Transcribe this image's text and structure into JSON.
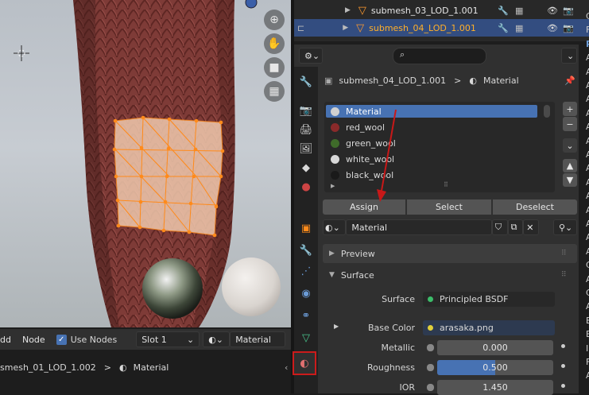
{
  "viewport": {
    "nav_icons": [
      "zoom-icon",
      "hand-pan-icon",
      "camera-icon",
      "grid-icon"
    ]
  },
  "viewport_header": {
    "menu_partial": "dd",
    "node_label": "Node",
    "use_nodes_label": "Use Nodes",
    "slot_value": "Slot 1",
    "material_value": "Material"
  },
  "viewport_breadcrumb": {
    "object": "smesh_01_LOD_1.002",
    "separator": ">",
    "material": "Material"
  },
  "outliner": {
    "rows": [
      {
        "name": "submesh_03_LOD_1.001",
        "selected": false
      },
      {
        "name": "submesh_04_LOD_1.001",
        "selected": true
      }
    ]
  },
  "properties": {
    "breadcrumb_object": "submesh_04_LOD_1.001",
    "breadcrumb_sep": ">",
    "breadcrumb_material": "Material",
    "material_slots": [
      "Material",
      "red_wool",
      "green_wool",
      "white_wool",
      "black_wool"
    ],
    "slot_colors": [
      "#d0d0d0",
      "#8a2a2a",
      "#3f6b2a",
      "#d8d8d8",
      "#1a1a1a"
    ],
    "assign_label": "Assign",
    "select_label": "Select",
    "deselect_label": "Deselect",
    "material_name": "Material",
    "preview_label": "Preview",
    "surface_label": "Surface",
    "surface_field_label": "Surface",
    "surface_value": "Principled BSDF",
    "base_color_label": "Base Color",
    "base_color_value": "arasaka.png",
    "metallic_label": "Metallic",
    "metallic_value": "0.000",
    "roughness_label": "Roughness",
    "roughness_value": "0.500",
    "roughness_fraction": 0.5,
    "ior_label": "IOR",
    "ior_value": "1.450"
  },
  "right_strip": {
    "chars": [
      "C",
      "F",
      "P",
      "A",
      "A",
      "A",
      "A",
      "A",
      "A",
      "A",
      "A",
      "A",
      "A",
      "A",
      "A",
      "A",
      "A",
      "A",
      "C",
      "A",
      "C",
      "A",
      "E",
      "E",
      "I",
      "F",
      "A"
    ]
  },
  "colors": {
    "selection_blue": "#4772b3",
    "active_orange": "#ffaf29",
    "highlight_red": "#cc1b1b",
    "field_gray": "#545454"
  }
}
